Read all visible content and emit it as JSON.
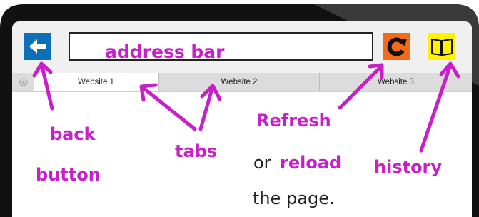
{
  "colors": {
    "annotation": "#c81fc8",
    "back_button": "#0d6fb8",
    "refresh_button": "#f26a1b",
    "history_button": "#fff200",
    "frame": "#111111"
  },
  "icons": {
    "back": "arrow-left-icon",
    "refresh": "refresh-icon",
    "history": "book-icon",
    "close_tab": "close-circle-icon"
  },
  "tabs": [
    {
      "label": "Website 1",
      "active": true
    },
    {
      "label": "Website 2",
      "active": false
    },
    {
      "label": "Website 3",
      "active": false
    }
  ],
  "annotations": {
    "address_bar": "address bar",
    "back_line1": "back",
    "back_line2": "button",
    "tabs": "tabs",
    "refresh": "Refresh",
    "or_word": "or",
    "reload": "reload",
    "the_page": "the page.",
    "history": "history"
  }
}
